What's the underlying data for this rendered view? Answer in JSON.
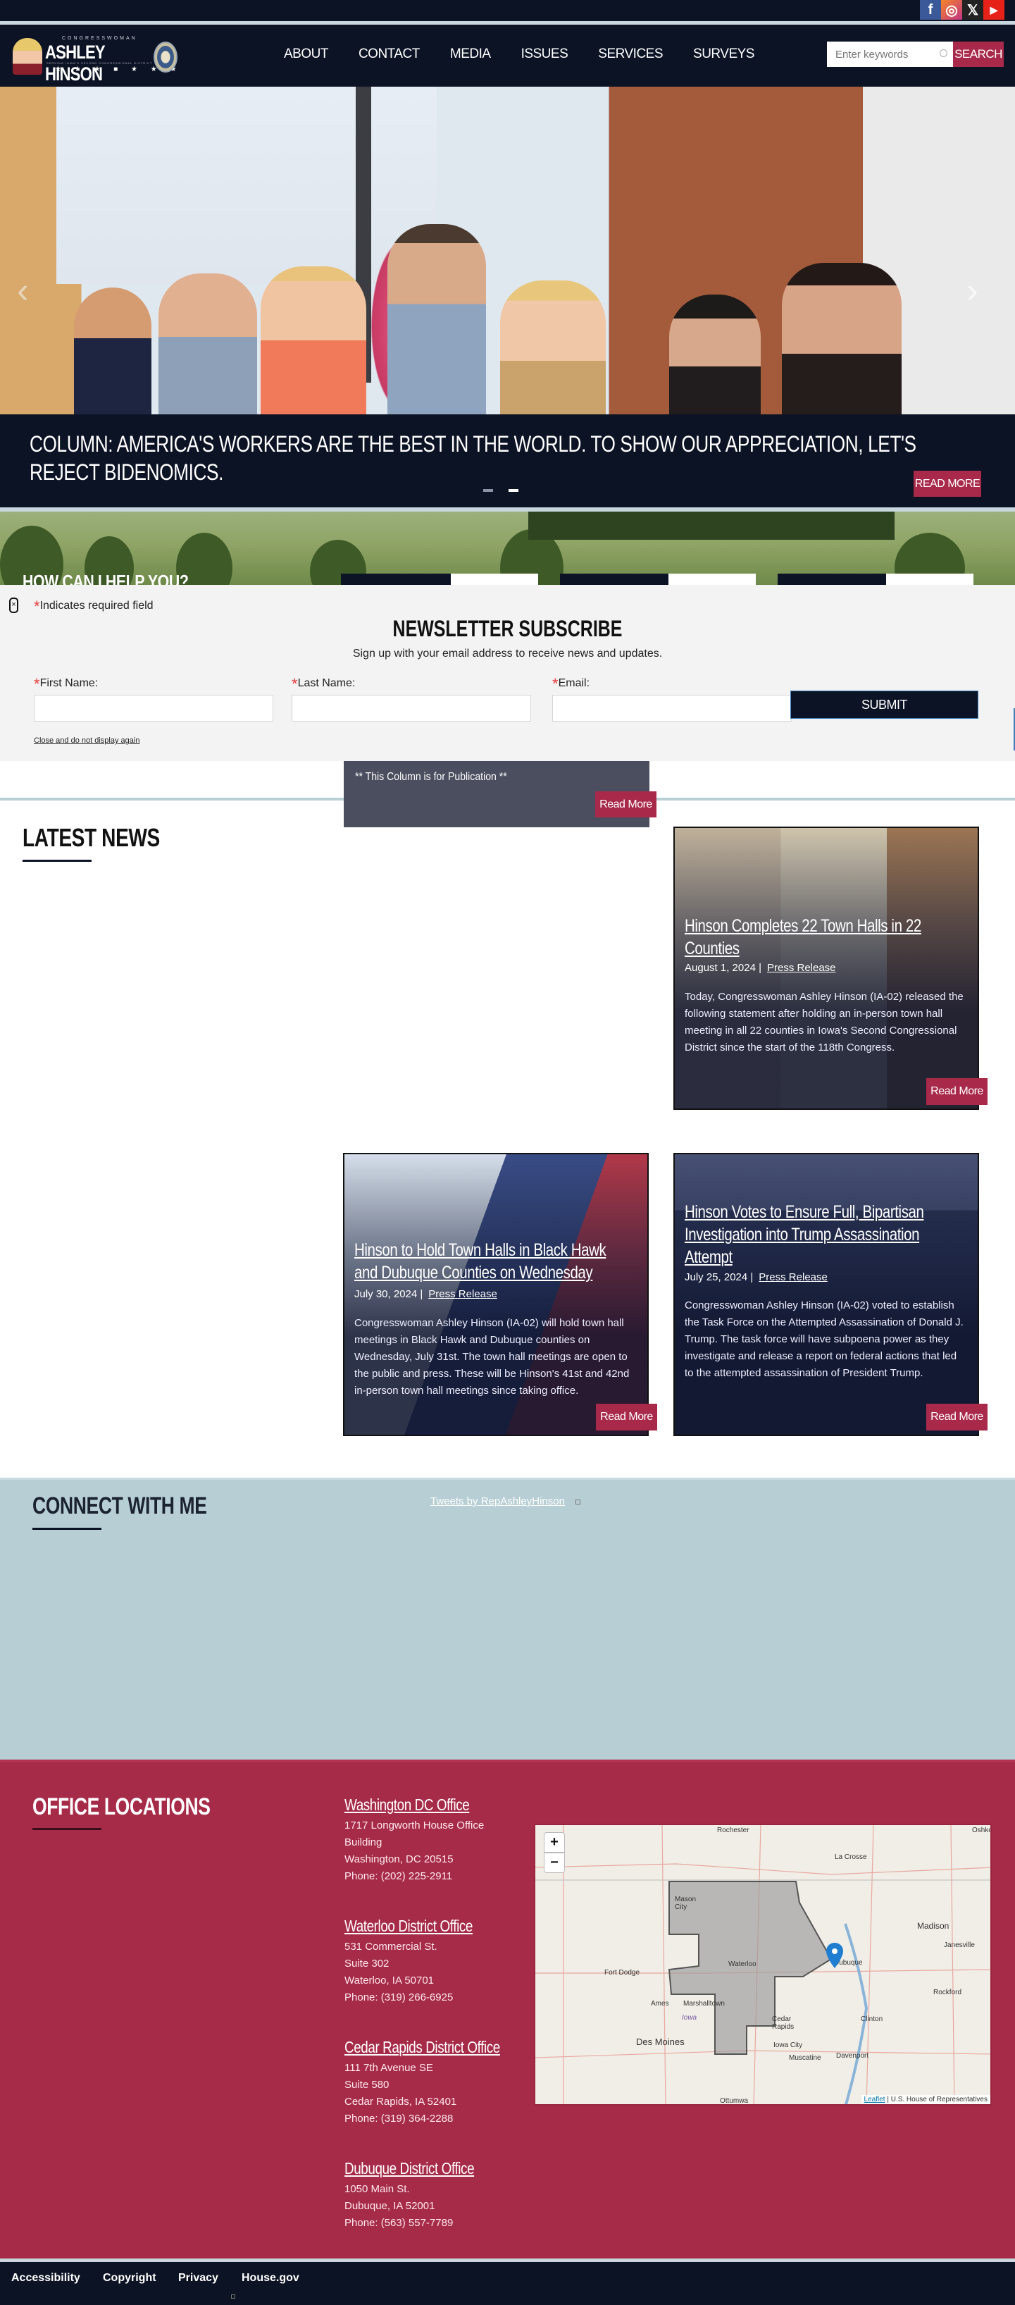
{
  "social": [
    {
      "name": "facebook",
      "glyph": "f",
      "color": "#3b5998"
    },
    {
      "name": "instagram",
      "glyph": "◎",
      "color": "#c13584"
    },
    {
      "name": "x",
      "glyph": "𝕏",
      "color": "#222222"
    },
    {
      "name": "youtube",
      "glyph": "▶",
      "color": "#e62117"
    }
  ],
  "logo": {
    "kicker": "CONGRESSWOMAN",
    "name": "ASHLEY HINSON",
    "tagline": "SERVING IOWA'S SECOND CONGRESSIONAL DISTRICT",
    "stars": "★ ★ ★ ■ ★ ★ ★"
  },
  "nav": [
    "ABOUT",
    "CONTACT",
    "MEDIA",
    "ISSUES",
    "SERVICES",
    "SURVEYS"
  ],
  "search": {
    "placeholder": "Enter keywords",
    "button": "SEARCH"
  },
  "hero": {
    "title": "COLUMN: AMERICA'S WORKERS ARE THE BEST IN THE WORLD. TO SHOW OUR APPRECIATION, LET'S REJECT BIDENOMICS.",
    "read_more": "READ MORE",
    "prev": "‹",
    "next": "›",
    "slides": 2,
    "active_slide": 2
  },
  "help": {
    "title": "HOW CAN I HELP YOU?"
  },
  "newsletter": {
    "close_glyph": "×",
    "required_star": "*",
    "required_note": "Indicates required field",
    "title": "NEWSLETTER SUBSCRIBE",
    "subtitle": "Sign up with your email address to receive news and updates.",
    "fields": [
      {
        "label": "First Name:",
        "value": ""
      },
      {
        "label": "Last Name:",
        "value": ""
      },
      {
        "label": "Email:",
        "value": ""
      }
    ],
    "submit": "SUBMIT",
    "dismiss": "Close and do not display again"
  },
  "publication_card": {
    "text": "** This Column is for Publication **",
    "read_more": "Read More"
  },
  "latest_news": {
    "title": "LATEST NEWS",
    "items": [
      {
        "title": "Hinson Completes 22 Town Halls in 22 Counties",
        "date": "August 1, 2024 |",
        "category": "Press Release",
        "summary": "Today, Congresswoman Ashley Hinson (IA-02) released the following statement after holding an in-person town hall meeting in all 22 counties in Iowa's Second Congressional District since the start of the 118th Congress.",
        "read_more": "Read More"
      },
      {
        "title": "Hinson to Hold Town Halls in Black Hawk and Dubuque Counties on Wednesday",
        "date": "July 30, 2024 |",
        "category": "Press Release",
        "summary": "Congresswoman Ashley Hinson (IA-02) will hold town hall meetings in Black Hawk and Dubuque counties on Wednesday, July 31st. The town hall meetings are open to the public and press. These will be Hinson's 41st and 42nd in-person town hall meetings since taking office.",
        "read_more": "Read More"
      },
      {
        "title": "Hinson Votes to Ensure Full, Bipartisan Investigation into Trump Assassination Attempt",
        "date": "July 25, 2024 |",
        "category": "Press Release",
        "summary": "Congresswoman Ashley Hinson (IA-02) voted to establish the Task Force on the Attempted Assassination of Donald J. Trump. The task force will have subpoena power as they investigate and release a report on federal actions that led to the attempted assassination of President Trump.",
        "read_more": "Read More"
      }
    ]
  },
  "connect": {
    "title": "CONNECT WITH ME",
    "tweets_link": "Tweets by RepAshleyHinson"
  },
  "offices": {
    "title": "OFFICE LOCATIONS",
    "items": [
      {
        "name": "Washington DC Office",
        "lines": [
          "1717 Longworth House Office",
          "Building",
          "Washington, DC 20515",
          "Phone: (202) 225-2911"
        ]
      },
      {
        "name": "Waterloo District Office",
        "lines": [
          "531 Commercial St.",
          "Suite 302",
          "Waterloo, IA 50701",
          "Phone: (319) 266-6925"
        ]
      },
      {
        "name": "Cedar Rapids District Office",
        "lines": [
          "111 7th Avenue SE",
          "Suite 580",
          "Cedar Rapids, IA 52401",
          "Phone: (319) 364-2288"
        ]
      },
      {
        "name": "Dubuque District Office",
        "lines": [
          "1050 Main St.",
          "Dubuque, IA 52001",
          "Phone: (563) 557-7789"
        ]
      }
    ]
  },
  "map": {
    "zoom_in": "+",
    "zoom_out": "−",
    "labels": [
      "Rochester",
      "La Crosse",
      "Oshkosh",
      "Mason City",
      "Madison",
      "Janesville",
      "Fort Dodge",
      "Waterloo",
      "Dubuque",
      "Rockford",
      "Ames",
      "Marshalltown",
      "Iowa",
      "Cedar Rapids",
      "Clinton",
      "Des Moines",
      "Iowa City",
      "Davenport",
      "Muscatine",
      "Ottumwa"
    ],
    "attribution_link": "Leaflet",
    "attribution_text": "| U.S. House of Representatives",
    "marker_color": "#1f7ed0"
  },
  "footer": [
    "Accessibility",
    "Copyright",
    "Privacy",
    "House.gov"
  ],
  "colors": {
    "navy": "#0c1325",
    "crimson": "#a8294a",
    "steel": "#b7cfd4"
  }
}
